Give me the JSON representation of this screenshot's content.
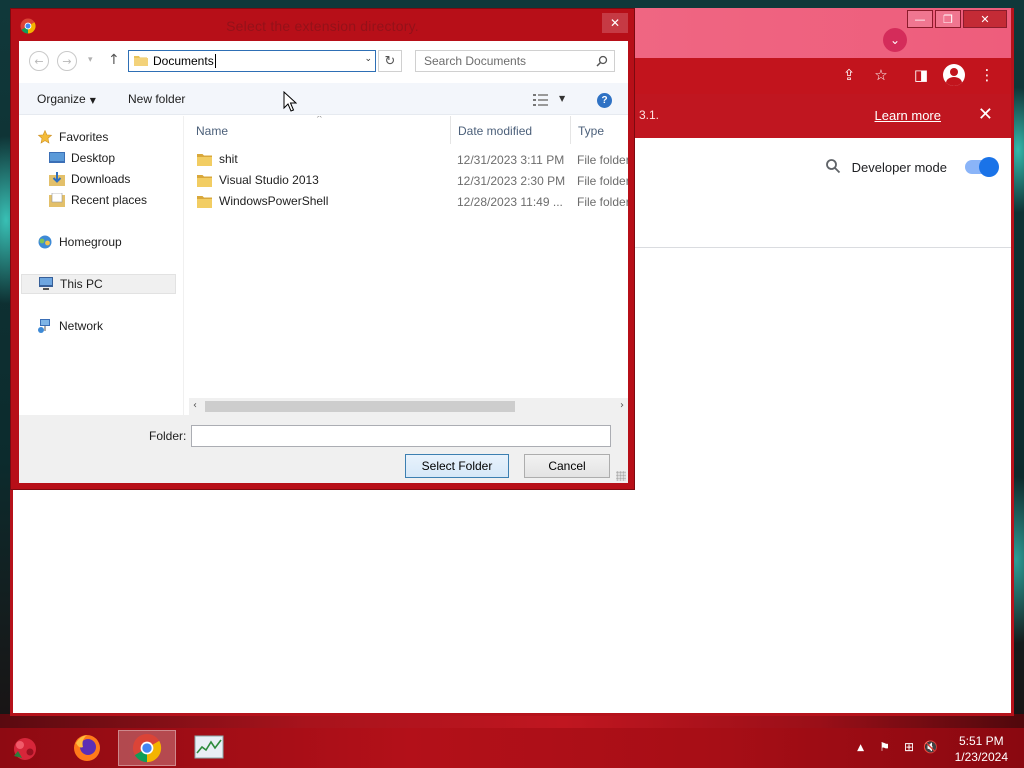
{
  "dialog": {
    "title": "Select the extension directory.",
    "close_glyph": "✕",
    "address_path": "Documents",
    "search_placeholder": "Search Documents",
    "toolbar": {
      "organize_label": "Organize",
      "new_folder_label": "New folder",
      "help_glyph": "?"
    },
    "nav_pane": {
      "favorites_label": "Favorites",
      "desktop_label": "Desktop",
      "downloads_label": "Downloads",
      "recent_places_label": "Recent places",
      "homegroup_label": "Homegroup",
      "this_pc_label": "This PC",
      "network_label": "Network"
    },
    "columns": {
      "name": "Name",
      "date_modified": "Date modified",
      "type": "Type"
    },
    "files": [
      {
        "name": "shit",
        "date": "12/31/2023 3:11 PM",
        "type": "File folder"
      },
      {
        "name": "Visual Studio 2013",
        "date": "12/31/2023 2:30 PM",
        "type": "File folder"
      },
      {
        "name": "WindowsPowerShell",
        "date": "12/28/2023 11:49 ...",
        "type": "File folder"
      }
    ],
    "folder_field_label": "Folder:",
    "folder_field_value": "",
    "select_folder_label": "Select Folder",
    "cancel_label": "Cancel"
  },
  "browser": {
    "infobar_text": "3.1.",
    "learn_more_label": "Learn more",
    "infobar_close_glyph": "✕",
    "developer_mode_label": "Developer mode",
    "developer_mode_on": true
  },
  "taskbar": {
    "time": "5:51 PM",
    "date": "1/23/2024"
  },
  "colors": {
    "dialog_frame": "#b70f18",
    "taskbar": "#b31019",
    "accent_blue": "#1a73e8"
  },
  "icons": [
    "chrome-icon",
    "back-arrow-icon",
    "forward-arrow-icon",
    "up-arrow-icon",
    "folder-icon",
    "refresh-icon",
    "search-icon",
    "view-options-icon",
    "help-icon",
    "star-icon",
    "desktop-icon",
    "downloads-icon",
    "recent-places-icon",
    "homegroup-icon",
    "computer-icon",
    "network-icon",
    "firefox-icon",
    "task-manager-icon",
    "flag-icon",
    "network-tray-icon",
    "volume-muted-icon"
  ]
}
